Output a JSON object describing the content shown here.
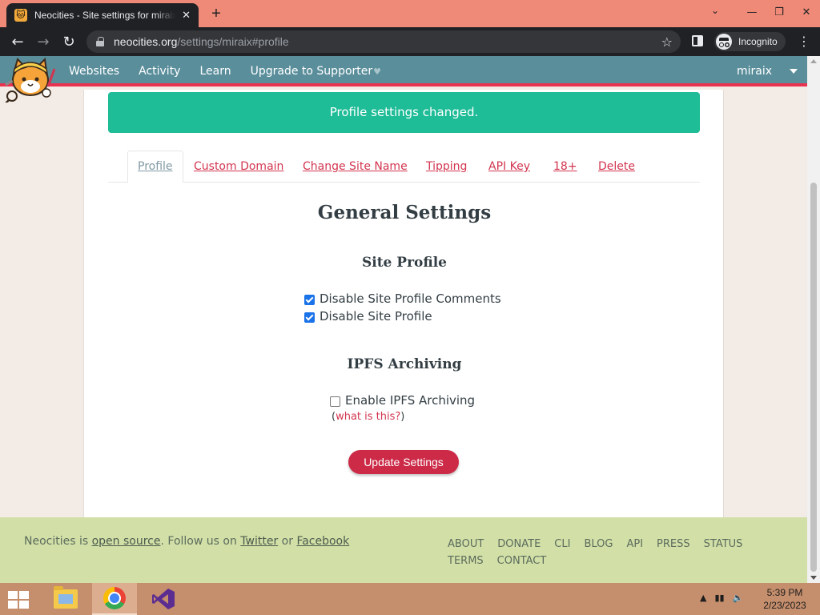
{
  "browser": {
    "tab_title": "Neocities - Site settings for miraix",
    "tab_close": "✕",
    "new_tab": "+",
    "url_host": "neocities.org",
    "url_path": "/settings/miraix#profile",
    "incognito_label": "Incognito"
  },
  "site": {
    "nav": [
      "Websites",
      "Activity",
      "Learn",
      "Upgrade to Supporter"
    ],
    "username": "miraix",
    "colors": {
      "header": "#5a8e9b",
      "accent": "#e93250",
      "alert": "#1ebc97",
      "footer": "#d2e0a8"
    }
  },
  "alert": {
    "message": "Profile settings changed."
  },
  "tabs": [
    {
      "label": "Profile",
      "active": true
    },
    {
      "label": "Custom Domain"
    },
    {
      "label": "Change Site Name"
    },
    {
      "label": "Tipping"
    },
    {
      "label": "API Key"
    },
    {
      "label": "18+"
    },
    {
      "label": "Delete"
    }
  ],
  "settings": {
    "title": "General Settings",
    "site_profile": {
      "heading": "Site Profile",
      "disable_comments": {
        "label": "Disable Site Profile Comments",
        "checked": true
      },
      "disable_profile": {
        "label": "Disable Site Profile",
        "checked": true
      }
    },
    "ipfs": {
      "heading": "IPFS Archiving",
      "enable": {
        "label": "Enable IPFS Archiving",
        "checked": false
      },
      "help_open": "(",
      "help_link": "what is this?",
      "help_close": ")"
    },
    "submit_label": "Update Settings"
  },
  "footer": {
    "prefix": "Neocities is ",
    "open_source": "open source",
    "follow": ". Follow us on ",
    "twitter": "Twitter",
    "or": " or ",
    "facebook": "Facebook",
    "links": [
      "ABOUT",
      "DONATE",
      "CLI",
      "BLOG",
      "API",
      "PRESS",
      "STATUS",
      "TERMS",
      "CONTACT"
    ]
  },
  "taskbar": {
    "time": "5:39 PM",
    "date": "2/23/2023"
  }
}
